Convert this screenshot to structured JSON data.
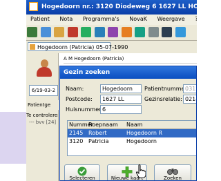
{
  "window": {
    "title": "Hogedoorn nr.: 3120 Diodeweg 6 1627 LL HOORN P: 0229-2"
  },
  "menu": [
    "Patient",
    "Nota",
    "Programma's",
    "NovaK",
    "Weergave",
    "?"
  ],
  "patient_tab": "Hogedoorn (Patricia) 05-07-1990",
  "patient_header": "A  M    Hogedoorn (Patricia)",
  "left_panel": {
    "date": "6/19-03-2",
    "tab_label": "Patientge",
    "controls_title": "Te controleren",
    "controls_item": "--- bvv [24]"
  },
  "dialog": {
    "title": "Gezin zoeken",
    "fields": {
      "naam_label": "Naam:",
      "naam_value": "Hogedoorn",
      "postcode_label": "Postcode:",
      "postcode_value": "1627 LL",
      "huisnummer_label": "Huisnummer:",
      "huisnummer_value": "6",
      "patientnummer_label": "Patientnummer:",
      "patientnummer_value": "03120",
      "gezinsrelatie_label": "Gezinsrelatie:",
      "gezinsrelatie_value": "02145"
    },
    "table": {
      "headers": [
        "Nummer",
        "Roepnaam",
        "Naam"
      ],
      "rows": [
        {
          "nummer": "2145",
          "roepnaam": "Robert",
          "naam": "Hogedoorn R"
        },
        {
          "nummer": "3120",
          "roepnaam": "Patricia",
          "naam": "Hogedoorn"
        }
      ]
    },
    "buttons": {
      "select": "Selecteren",
      "new": "Nieuwe kaart",
      "search": "Zoeken"
    }
  },
  "colors": {
    "title": "#0a3ea8",
    "selection": "#316ac5",
    "lavender": "#dcd5f0"
  }
}
